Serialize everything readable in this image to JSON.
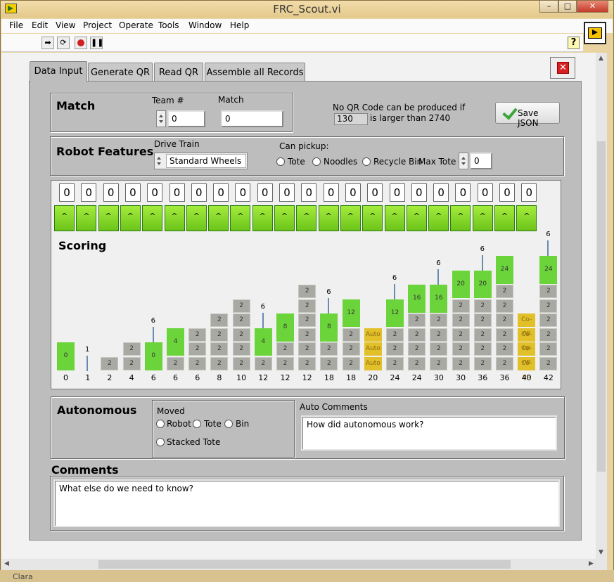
{
  "window": {
    "title": "FRC_Scout.vi"
  },
  "menu": [
    "File",
    "Edit",
    "View",
    "Project",
    "Operate",
    "Tools",
    "Window",
    "Help"
  ],
  "tabs": [
    "Data Input",
    "Generate QR",
    "Read QR",
    "Assemble all Records"
  ],
  "match": {
    "heading": "Match",
    "team_label": "Team #",
    "team_value": "0",
    "match_label": "Match",
    "match_value": "0",
    "qr_note_line1": "No QR Code can be produced if",
    "qr_value": "130",
    "qr_note_line2": "is larger than 2740",
    "save_label": "Save JSON"
  },
  "robot": {
    "heading": "Robot Features",
    "drive_label": "Drive Train",
    "drive_value": "Standard Wheels",
    "pickup_label": "Can pickup:",
    "options": [
      "Tote",
      "Noodles",
      "Recycle Bin"
    ],
    "max_tote_label": "Max Tote",
    "max_tote_value": "0"
  },
  "scoring": {
    "heading": "Scoring",
    "counts": [
      "0",
      "0",
      "0",
      "0",
      "0",
      "0",
      "0",
      "0",
      "0",
      "0",
      "0",
      "0",
      "0",
      "0",
      "0",
      "0",
      "0",
      "0",
      "0",
      "0",
      "0",
      "0"
    ],
    "button_glyph": "^",
    "columns": [
      {
        "label": "0",
        "blocks": [
          {
            "t": "green",
            "v": "0",
            "h": 2
          }
        ],
        "pole": null
      },
      {
        "label": "1",
        "blocks": [],
        "pole": "1"
      },
      {
        "label": "2",
        "blocks": [
          {
            "t": "gray",
            "v": "2"
          }
        ],
        "pole": null
      },
      {
        "label": "4",
        "blocks": [
          {
            "t": "gray",
            "v": "2"
          },
          {
            "t": "gray",
            "v": "2"
          }
        ],
        "pole": null
      },
      {
        "label": "6",
        "blocks": [
          {
            "t": "green",
            "v": "0",
            "h": 2
          }
        ],
        "pole": "6"
      },
      {
        "label": "6",
        "blocks": [
          {
            "t": "gray",
            "v": "2"
          },
          {
            "t": "green",
            "v": "4",
            "h": 2
          }
        ],
        "pole": null
      },
      {
        "label": "6",
        "blocks": [
          {
            "t": "gray",
            "v": "2"
          },
          {
            "t": "gray",
            "v": "2"
          },
          {
            "t": "gray",
            "v": "2"
          }
        ],
        "pole": null
      },
      {
        "label": "8",
        "blocks": [
          {
            "t": "gray",
            "v": "2"
          },
          {
            "t": "gray",
            "v": "2"
          },
          {
            "t": "gray",
            "v": "2"
          },
          {
            "t": "gray",
            "v": "2"
          }
        ],
        "pole": null
      },
      {
        "label": "10",
        "blocks": [
          {
            "t": "gray",
            "v": "2"
          },
          {
            "t": "gray",
            "v": "2"
          },
          {
            "t": "gray",
            "v": "2"
          },
          {
            "t": "gray",
            "v": "2"
          },
          {
            "t": "gray",
            "v": "2"
          }
        ],
        "pole": null
      },
      {
        "label": "12",
        "blocks": [
          {
            "t": "gray",
            "v": "2"
          },
          {
            "t": "green",
            "v": "4",
            "h": 2
          }
        ],
        "pole": "6"
      },
      {
        "label": "12",
        "blocks": [
          {
            "t": "gray",
            "v": "2"
          },
          {
            "t": "gray",
            "v": "2"
          },
          {
            "t": "green",
            "v": "8",
            "h": 2
          }
        ],
        "pole": null
      },
      {
        "label": "12",
        "blocks": [
          {
            "t": "gray",
            "v": "2"
          },
          {
            "t": "gray",
            "v": "2"
          },
          {
            "t": "gray",
            "v": "2"
          },
          {
            "t": "gray",
            "v": "2"
          },
          {
            "t": "gray",
            "v": "2"
          },
          {
            "t": "gray",
            "v": "2"
          }
        ],
        "pole": null
      },
      {
        "label": "18",
        "blocks": [
          {
            "t": "gray",
            "v": "2"
          },
          {
            "t": "gray",
            "v": "2"
          },
          {
            "t": "green",
            "v": "8",
            "h": 2
          }
        ],
        "pole": "6"
      },
      {
        "label": "18",
        "blocks": [
          {
            "t": "gray",
            "v": "2"
          },
          {
            "t": "gray",
            "v": "2"
          },
          {
            "t": "gray",
            "v": "2"
          },
          {
            "t": "green",
            "v": "12",
            "h": 2
          }
        ],
        "pole": null
      },
      {
        "label": "20",
        "blocks": [
          {
            "t": "yellow",
            "v": "Auto"
          },
          {
            "t": "yellow",
            "v": "Auto"
          },
          {
            "t": "yellow",
            "v": "Auto"
          }
        ],
        "pole": null
      },
      {
        "label": "24",
        "blocks": [
          {
            "t": "gray",
            "v": "2"
          },
          {
            "t": "gray",
            "v": "2"
          },
          {
            "t": "gray",
            "v": "2"
          },
          {
            "t": "green",
            "v": "12",
            "h": 2
          }
        ],
        "pole": "6"
      },
      {
        "label": "24",
        "blocks": [
          {
            "t": "gray",
            "v": "2"
          },
          {
            "t": "gray",
            "v": "2"
          },
          {
            "t": "gray",
            "v": "2"
          },
          {
            "t": "gray",
            "v": "2"
          },
          {
            "t": "green",
            "v": "16",
            "h": 2
          }
        ],
        "pole": null
      },
      {
        "label": "30",
        "blocks": [
          {
            "t": "gray",
            "v": "2"
          },
          {
            "t": "gray",
            "v": "2"
          },
          {
            "t": "gray",
            "v": "2"
          },
          {
            "t": "gray",
            "v": "2"
          },
          {
            "t": "green",
            "v": "16",
            "h": 2
          }
        ],
        "pole": "6"
      },
      {
        "label": "30",
        "blocks": [
          {
            "t": "gray",
            "v": "2"
          },
          {
            "t": "gray",
            "v": "2"
          },
          {
            "t": "gray",
            "v": "2"
          },
          {
            "t": "gray",
            "v": "2"
          },
          {
            "t": "gray",
            "v": "2"
          },
          {
            "t": "green",
            "v": "20",
            "h": 2
          }
        ],
        "pole": null
      },
      {
        "label": "36",
        "blocks": [
          {
            "t": "gray",
            "v": "2"
          },
          {
            "t": "gray",
            "v": "2"
          },
          {
            "t": "gray",
            "v": "2"
          },
          {
            "t": "gray",
            "v": "2"
          },
          {
            "t": "gray",
            "v": "2"
          },
          {
            "t": "green",
            "v": "20",
            "h": 2
          }
        ],
        "pole": "6"
      },
      {
        "label": "36",
        "blocks": [
          {
            "t": "gray",
            "v": "2"
          },
          {
            "t": "gray",
            "v": "2"
          },
          {
            "t": "gray",
            "v": "2"
          },
          {
            "t": "gray",
            "v": "2"
          },
          {
            "t": "gray",
            "v": "2"
          },
          {
            "t": "gray",
            "v": "2"
          },
          {
            "t": "green",
            "v": "24",
            "h": 2
          }
        ],
        "pole": null
      },
      {
        "label": "40",
        "blocks": [
          {
            "t": "yellow",
            "v": "Co-op"
          },
          {
            "t": "yellow",
            "v": "Co-op"
          },
          {
            "t": "yellow",
            "v": "Co-op"
          },
          {
            "t": "yellow",
            "v": "Co-op"
          }
        ],
        "pole": null
      },
      {
        "label": "42",
        "blocks": [
          {
            "t": "gray",
            "v": "2"
          },
          {
            "t": "gray",
            "v": "2"
          },
          {
            "t": "gray",
            "v": "2"
          },
          {
            "t": "gray",
            "v": "2"
          },
          {
            "t": "gray",
            "v": "2"
          },
          {
            "t": "gray",
            "v": "2"
          },
          {
            "t": "green",
            "v": "24",
            "h": 2
          }
        ],
        "pole": "6"
      }
    ]
  },
  "autonomous": {
    "heading": "Autonomous",
    "moved_label": "Moved",
    "options": [
      "Robot",
      "Tote",
      "Bin",
      "Stacked Tote"
    ],
    "comments_label": "Auto Comments",
    "comments_value": "How did autonomous work?"
  },
  "comments": {
    "heading": "Comments",
    "value": "What else do we need to know?"
  },
  "taskbar": {
    "left_text": "Clara"
  },
  "colors": {
    "green": "#6bd43a",
    "gray": "#a9a9a4",
    "yellow": "#e2c02a",
    "button_green": "#8fdc2e"
  }
}
